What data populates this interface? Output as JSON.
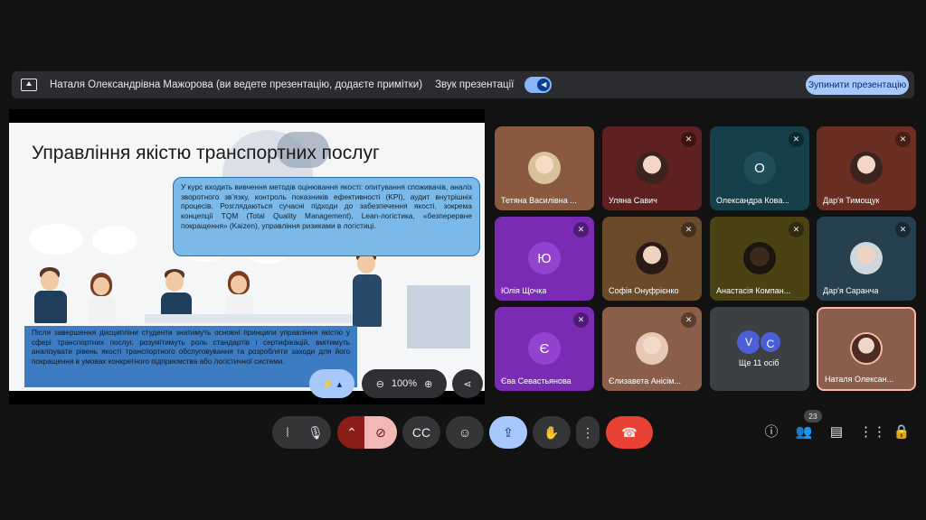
{
  "banner": {
    "message": "Наталя Олександрівна Мажорова (ви ведете презентацію, додаєте примітки)",
    "sound_label": "Звук презентації",
    "stop_label": "Зупинити презентацію"
  },
  "slide": {
    "title": "Управління якістю транспортних послуг",
    "box1": "У курс входить вивчення методів оцінювання якості: опитування споживачів, аналіз зворотного зв’язку, контроль показників ефективності (KPI), аудит внутрішніх процесів. Розглядаються сучасні підходи до забезпечення якості, зокрема концепції TQM (Total Quality Management), Lean-логістика, «безперервне покращення» (Kaizen), управління ризиками в логістиці.",
    "box2": "Після завершення дисципліни студенти знатимуть основні принципи управління якістю у сфері транспортних послуг, розумітимуть роль стандартів і сертифікацій, вмітимуть аналізувати рівень якості транспортного обслуговування та розробляти заходи для його покращення в умовах конкретного підприємства або логістичної системи."
  },
  "slide_toolbar": {
    "zoom": "100%"
  },
  "tiles": [
    {
      "name": "Тетяна Василівна ...",
      "bg": "#8a5a40"
    },
    {
      "name": "Уляна Савич",
      "bg": "#5e2020"
    },
    {
      "name": "Олександра Кова...",
      "bg": "#153f4a",
      "initial": "О",
      "avatar_bg": "#1f4d5a"
    },
    {
      "name": "Дар'я Тимощук",
      "bg": "#6a2e22"
    },
    {
      "name": "Юлія Щочка",
      "bg": "#7a2bb4",
      "initial": "Ю",
      "avatar_bg": "#9443d0"
    },
    {
      "name": "Софія Онуфрієнко",
      "bg": "#6a4a28"
    },
    {
      "name": "Анастасія Компан...",
      "bg": "#4a4212"
    },
    {
      "name": "Дар'я Саранча",
      "bg": "#26404f"
    },
    {
      "name": "Єва Севастьянова",
      "bg": "#7a2bb4",
      "initial": "Є",
      "avatar_bg": "#9443d0"
    },
    {
      "name": "Єлизавета Анісім...",
      "bg": "#8a5e48"
    },
    {
      "name": "Ще 11 осіб",
      "bg": "#3c4043",
      "initials": [
        "V",
        "C"
      ]
    },
    {
      "name": "Наталя Олексан...",
      "bg": "#8a5e4a"
    }
  ],
  "controls": {
    "participants_count": "23"
  },
  "colors": {
    "accent": "#a8c7fa",
    "end_call": "#ea4335"
  }
}
